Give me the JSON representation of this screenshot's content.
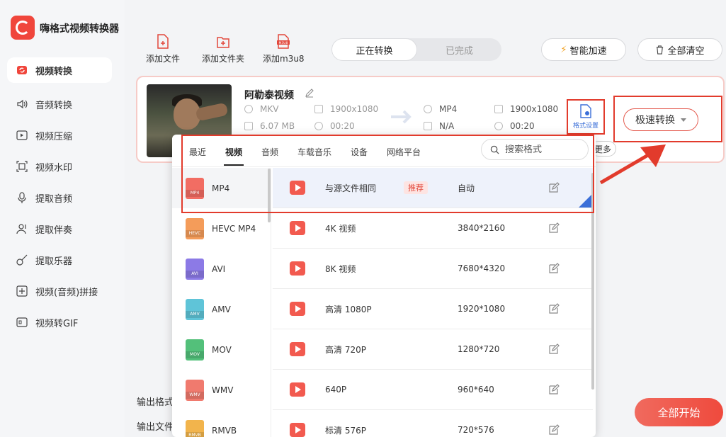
{
  "app": {
    "title": "嗨格式视频转换器"
  },
  "sidebar": {
    "items": [
      {
        "label": "视频转换",
        "icon": "video-convert-icon",
        "active": true
      },
      {
        "label": "音频转换",
        "icon": "speaker-icon"
      },
      {
        "label": "视频压缩",
        "icon": "video-compress-icon"
      },
      {
        "label": "视频水印",
        "icon": "watermark-icon"
      },
      {
        "label": "提取音频",
        "icon": "microphone-icon"
      },
      {
        "label": "提取伴奏",
        "icon": "accompaniment-icon"
      },
      {
        "label": "提取乐器",
        "icon": "guitar-icon"
      },
      {
        "label": "视频(音频)拼接",
        "icon": "merge-icon"
      },
      {
        "label": "视频转GIF",
        "icon": "gif-icon"
      }
    ]
  },
  "toolbar": {
    "add_file": "添加文件",
    "add_folder": "添加文件夹",
    "add_m3u8": "添加m3u8",
    "m3u8_badge": "M3U8",
    "tab_converting": "正在转换",
    "tab_done": "已完成",
    "smart_accel": "智能加速",
    "clear_all": "全部清空"
  },
  "file": {
    "name": "阿勒泰视频",
    "src_format": "MKV",
    "src_resolution": "1900x1080",
    "src_size": "6.07 MB",
    "src_duration": "00:20",
    "dst_format": "MP4",
    "dst_resolution": "1900x1080",
    "dst_size": "N/A",
    "dst_duration": "00:20",
    "format_settings": "格式设置",
    "speed_convert": "极速转换",
    "more_peek": "更多"
  },
  "popup": {
    "tabs": [
      "最近",
      "视频",
      "音频",
      "车载音乐",
      "设备",
      "网络平台"
    ],
    "active_tab": "视频",
    "search_placeholder": "搜索格式",
    "formats": [
      {
        "label": "MP4",
        "badge": "MP4",
        "color": "#f26d63"
      },
      {
        "label": "HEVC MP4",
        "badge": "HEVC",
        "color": "#f49c5a"
      },
      {
        "label": "AVI",
        "badge": "AVI",
        "color": "#8c7ae6"
      },
      {
        "label": "AMV",
        "badge": "AMV",
        "color": "#5fc4d8"
      },
      {
        "label": "MOV",
        "badge": "MOV",
        "color": "#53c07a"
      },
      {
        "label": "WMV",
        "badge": "WMV",
        "color": "#f07a6e"
      },
      {
        "label": "RMVB",
        "badge": "RMVB",
        "color": "#f2b44c"
      }
    ],
    "presets": [
      {
        "name": "与源文件相同",
        "tag": "推荐",
        "resolution": "自动"
      },
      {
        "name": "4K 视频",
        "resolution": "3840*2160"
      },
      {
        "name": "8K 视频",
        "resolution": "7680*4320"
      },
      {
        "name": "高清 1080P",
        "resolution": "1920*1080"
      },
      {
        "name": "高清 720P",
        "resolution": "1280*720"
      },
      {
        "name": "640P",
        "resolution": "960*640"
      },
      {
        "name": "标清 576P",
        "resolution": "720*576"
      }
    ]
  },
  "bottom": {
    "output_format": "输出格式",
    "output_file": "输出文件",
    "start_all": "全部开始"
  },
  "colors": {
    "accent": "#ef4a3d",
    "link_blue": "#3b6fd8",
    "highlight_red": "#e23b2c"
  }
}
